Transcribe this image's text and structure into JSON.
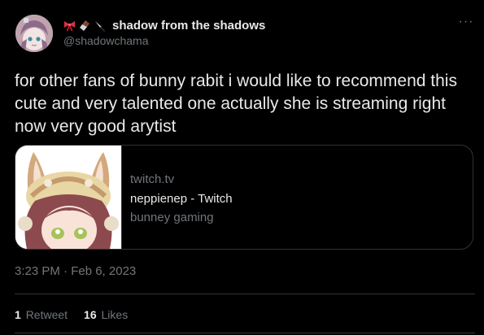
{
  "author": {
    "display_name": "shadow from the shadows",
    "handle": "@shadowchama",
    "name_emojis": [
      "ribbon-icon",
      "chocolate-bar-icon",
      "knife-icon"
    ]
  },
  "tweet": {
    "text": "for other fans of bunny rabit i would like to recommend this cute and very talented one actually she is streaming right now very good arytist",
    "timestamp": "3:23 PM · Feb 6, 2023"
  },
  "card": {
    "domain": "twitch.tv",
    "title": "neppienep - Twitch",
    "description": "bunney gaming"
  },
  "stats": {
    "retweets_count": "1",
    "retweets_label": "Retweet",
    "likes_count": "16",
    "likes_label": "Likes"
  },
  "menu": {
    "more_label": "···"
  },
  "colors": {
    "background": "#000000",
    "text_primary": "#e7e9ea",
    "text_secondary": "#71767b",
    "border": "#2f3336"
  }
}
